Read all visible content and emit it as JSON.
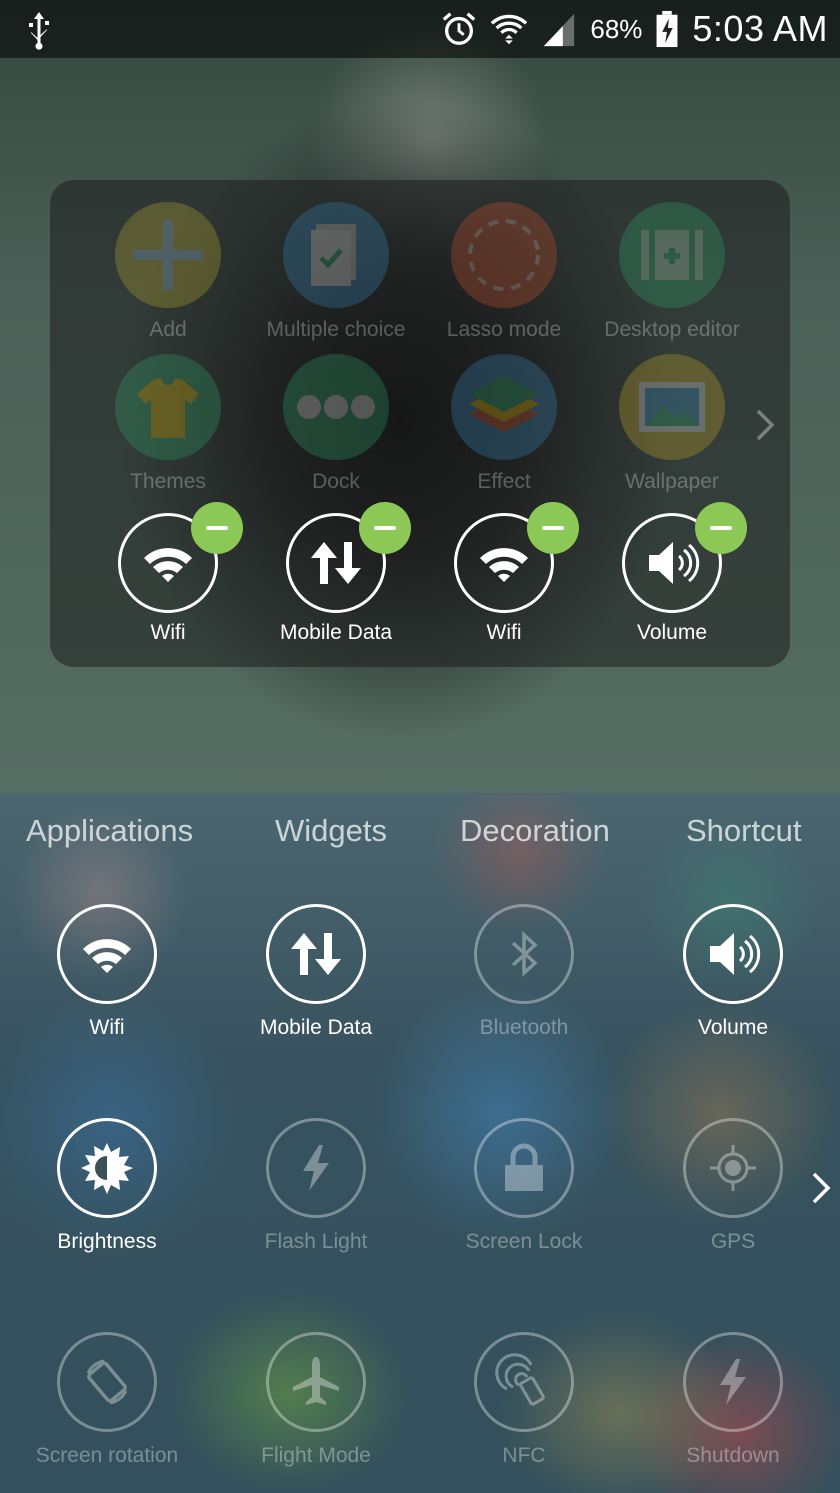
{
  "status_bar": {
    "usb_icon": "usb-icon",
    "alarm_icon": "alarm-icon",
    "wifi_icon": "wifi-signal-icon",
    "cell_icon": "cell-signal-icon",
    "battery_percent": "68%",
    "battery_icon": "battery-charging-icon",
    "time": "5:03 AM"
  },
  "panel": {
    "apps": [
      {
        "label": "Add",
        "icon": "add-icon",
        "color": "#c9b52d"
      },
      {
        "label": "Multiple choice",
        "icon": "multiple-choice-icon",
        "color": "#3a8fc9"
      },
      {
        "label": "Lasso mode",
        "icon": "lasso-icon",
        "color": "#e0552f"
      },
      {
        "label": "Desktop editor",
        "icon": "desktop-editor-icon",
        "color": "#2fae6f"
      },
      {
        "label": "Themes",
        "icon": "themes-icon",
        "color": "#2fae6f"
      },
      {
        "label": "Dock",
        "icon": "dock-icon",
        "color": "#2fae6f"
      },
      {
        "label": "Effect",
        "icon": "effect-icon",
        "color": "#3a8fc9"
      },
      {
        "label": "Wallpaper",
        "icon": "wallpaper-icon",
        "color": "#d9b225"
      }
    ],
    "selected": [
      {
        "label": "Wifi",
        "icon": "wifi-icon"
      },
      {
        "label": "Mobile Data",
        "icon": "mobile-data-icon"
      },
      {
        "label": "Wifi",
        "icon": "wifi-icon"
      },
      {
        "label": "Volume",
        "icon": "volume-icon"
      }
    ],
    "remove_badge_color": "#8cc856"
  },
  "tabs": [
    "Applications",
    "Widgets",
    "Decoration",
    "Shortcut"
  ],
  "shortcuts": [
    {
      "label": "Wifi",
      "icon": "wifi-icon",
      "enabled": true
    },
    {
      "label": "Mobile Data",
      "icon": "mobile-data-icon",
      "enabled": true
    },
    {
      "label": "Bluetooth",
      "icon": "bluetooth-icon",
      "enabled": false
    },
    {
      "label": "Volume",
      "icon": "volume-icon",
      "enabled": true
    },
    {
      "label": "Brightness",
      "icon": "brightness-icon",
      "enabled": true
    },
    {
      "label": "Flash Light",
      "icon": "flashlight-icon",
      "enabled": false
    },
    {
      "label": "Screen Lock",
      "icon": "lock-icon",
      "enabled": false
    },
    {
      "label": "GPS",
      "icon": "gps-icon",
      "enabled": false
    },
    {
      "label": "Screen rotation",
      "icon": "rotation-icon",
      "enabled": false
    },
    {
      "label": "Flight Mode",
      "icon": "airplane-icon",
      "enabled": false
    },
    {
      "label": "NFC",
      "icon": "nfc-icon",
      "enabled": false
    },
    {
      "label": "Shutdown",
      "icon": "shutdown-icon",
      "enabled": false
    }
  ]
}
